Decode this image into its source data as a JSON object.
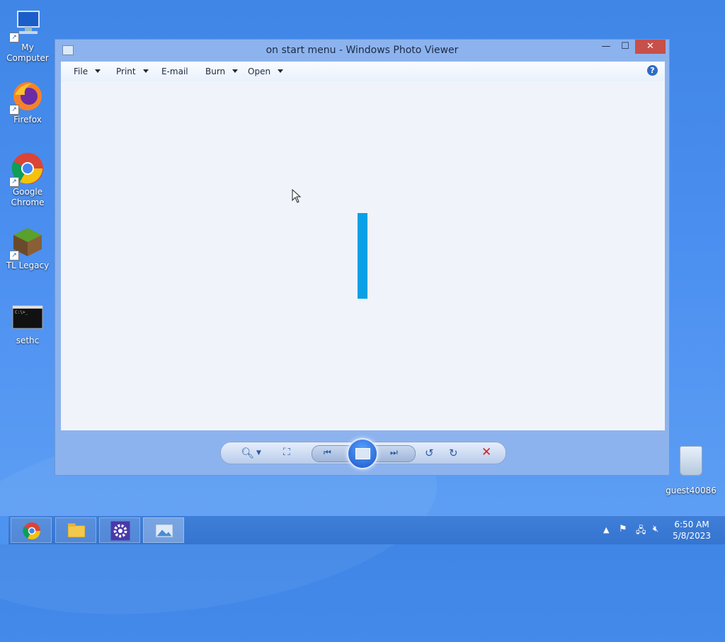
{
  "desktop": {
    "icons": [
      {
        "label": "My Computer"
      },
      {
        "label": "Firefox"
      },
      {
        "label": "Google Chrome"
      },
      {
        "label": "TL Legacy"
      },
      {
        "label": "sethc"
      }
    ],
    "recycle_label": "guest40086"
  },
  "window": {
    "title": "on start menu - Windows Photo Viewer",
    "controls": {
      "min": "—",
      "max": "☐",
      "close": "✕"
    },
    "menu": [
      "File",
      "Print",
      "E-mail",
      "Burn",
      "Open"
    ],
    "help": "?"
  },
  "taskbar": {
    "time": "6:50 AM",
    "date": "5/8/2023"
  },
  "colors": {
    "desktop": "#4b8ff0",
    "image_bar": "#0aa0e6",
    "close_button": "#c7504a"
  }
}
